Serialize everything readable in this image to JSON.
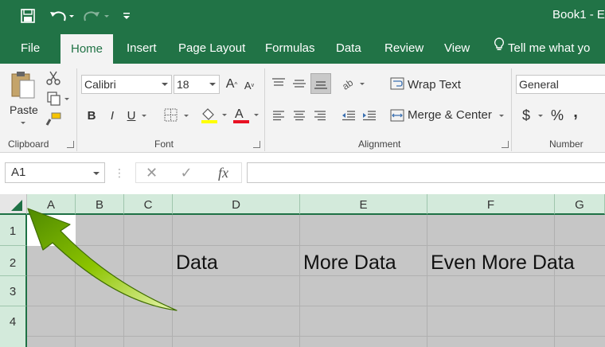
{
  "title_bar": {
    "book_title": "Book1 - E",
    "icons": [
      "save-icon",
      "undo-icon",
      "redo-icon",
      "customize-qat-icon"
    ]
  },
  "tabs": [
    {
      "label": "File",
      "active": false
    },
    {
      "label": "Home",
      "active": true
    },
    {
      "label": "Insert",
      "active": false
    },
    {
      "label": "Page Layout",
      "active": false
    },
    {
      "label": "Formulas",
      "active": false
    },
    {
      "label": "Data",
      "active": false
    },
    {
      "label": "Review",
      "active": false
    },
    {
      "label": "View",
      "active": false
    }
  ],
  "tell_me": "Tell me what yo",
  "ribbon": {
    "clipboard": {
      "paste_label": "Paste",
      "group_label": "Clipboard"
    },
    "font": {
      "font_name": "Calibri",
      "font_size": "18",
      "bold": "B",
      "italic": "I",
      "underline": "U",
      "group_label": "Font"
    },
    "alignment": {
      "wrap_text": "Wrap Text",
      "merge_center": "Merge & Center",
      "group_label": "Alignment"
    },
    "number": {
      "format": "General",
      "currency": "$",
      "percent": "%",
      "comma": ",",
      "group_label": "Number"
    }
  },
  "formula_bar": {
    "name_box": "A1",
    "cancel": "✕",
    "enter": "✓",
    "fx": "fx",
    "formula": ""
  },
  "columns": [
    "A",
    "B",
    "C",
    "D",
    "E",
    "F",
    "G"
  ],
  "rows": [
    "1",
    "2",
    "3",
    "4"
  ],
  "cells": {
    "D2": "Data",
    "E2": "More Data",
    "F2": "Even More Data"
  },
  "colors": {
    "excel_green": "#217346",
    "header_selected": "#d3eadb",
    "selection_fill": "#c6c6c6",
    "arrow_green": "#7fb800"
  }
}
